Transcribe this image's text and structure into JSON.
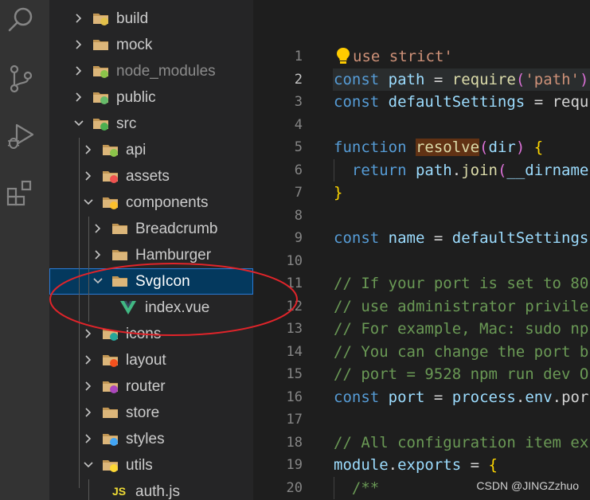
{
  "activity_bar": {
    "icons": [
      "search-icon",
      "source-control-icon",
      "run-debug-icon",
      "extensions-icon"
    ]
  },
  "explorer": {
    "items": [
      {
        "label": "build",
        "icon": "folder-build-icon",
        "expanded": false,
        "level": 1
      },
      {
        "label": "mock",
        "icon": "folder-icon",
        "expanded": false,
        "level": 1
      },
      {
        "label": "node_modules",
        "icon": "folder-node-icon",
        "expanded": false,
        "level": 1,
        "dim": true
      },
      {
        "label": "public",
        "icon": "folder-public-icon",
        "expanded": false,
        "level": 1
      },
      {
        "label": "src",
        "icon": "folder-src-icon",
        "expanded": true,
        "level": 1
      },
      {
        "label": "api",
        "icon": "folder-api-icon",
        "expanded": false,
        "level": 2
      },
      {
        "label": "assets",
        "icon": "folder-assets-icon",
        "expanded": false,
        "level": 2
      },
      {
        "label": "components",
        "icon": "folder-components-icon",
        "expanded": true,
        "level": 2
      },
      {
        "label": "Breadcrumb",
        "icon": "folder-icon",
        "expanded": false,
        "level": 3
      },
      {
        "label": "Hamburger",
        "icon": "folder-icon",
        "expanded": false,
        "level": 3
      },
      {
        "label": "SvgIcon",
        "icon": "folder-open-icon",
        "expanded": true,
        "level": 3,
        "selected": true
      },
      {
        "label": "index.vue",
        "icon": "vue-file-icon",
        "level": 4,
        "file": true
      },
      {
        "label": "icons",
        "icon": "folder-images-icon",
        "expanded": false,
        "level": 2
      },
      {
        "label": "layout",
        "icon": "folder-layout-icon",
        "expanded": false,
        "level": 2
      },
      {
        "label": "router",
        "icon": "folder-router-icon",
        "expanded": false,
        "level": 2
      },
      {
        "label": "store",
        "icon": "folder-icon",
        "expanded": false,
        "level": 2
      },
      {
        "label": "styles",
        "icon": "folder-styles-icon",
        "expanded": false,
        "level": 2
      },
      {
        "label": "utils",
        "icon": "folder-utils-icon",
        "expanded": true,
        "level": 2
      },
      {
        "label": "auth.js",
        "icon": "js-file-icon",
        "level": 3,
        "file": true
      }
    ]
  },
  "editor": {
    "active_line": 2,
    "line_numbers": [
      "1",
      "2",
      "3",
      "4",
      "5",
      "6",
      "7",
      "8",
      "9",
      "10",
      "11",
      "12",
      "13",
      "14",
      "15",
      "16",
      "17",
      "18",
      "19",
      "20"
    ],
    "lines": [
      "use strict'",
      "const path = require('path')",
      "const defaultSettings = requ",
      "",
      "function resolve(dir) {",
      "  return path.join(__dirname",
      "}",
      "",
      "const name = defaultSettings",
      "",
      "// If your port is set to 80",
      "// use administrator privile",
      "// For example, Mac: sudo np",
      "// You can change the port b",
      "// port = 9528 npm run dev O",
      "const port = process.env.por",
      "",
      "// All configuration item ex",
      "module.exports = {",
      "  /**"
    ]
  },
  "watermark": "CSDN @JINGZzhuo"
}
